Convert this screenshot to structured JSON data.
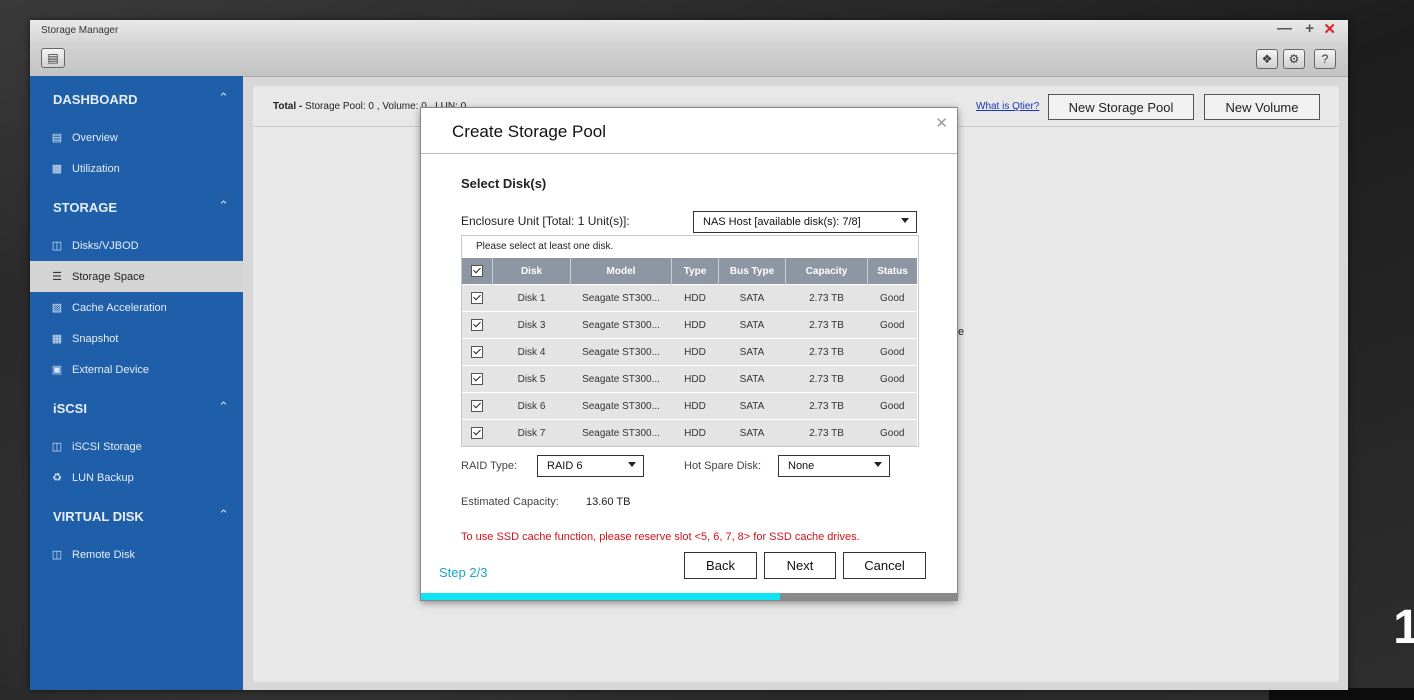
{
  "window": {
    "title": "Storage Manager"
  },
  "sidebar": {
    "sections": [
      {
        "label": "DASHBOARD",
        "items": [
          {
            "label": "Overview",
            "icon": "overview-icon"
          },
          {
            "label": "Utilization",
            "icon": "utilization-icon"
          }
        ]
      },
      {
        "label": "STORAGE",
        "items": [
          {
            "label": "Disks/VJBOD",
            "icon": "disk-icon"
          },
          {
            "label": "Storage Space",
            "icon": "storage-space-icon"
          },
          {
            "label": "Cache Acceleration",
            "icon": "cache-icon"
          },
          {
            "label": "Snapshot",
            "icon": "snapshot-icon"
          },
          {
            "label": "External Device",
            "icon": "external-device-icon"
          }
        ]
      },
      {
        "label": "iSCSI",
        "items": [
          {
            "label": "iSCSI Storage",
            "icon": "iscsi-storage-icon"
          },
          {
            "label": "LUN Backup",
            "icon": "lun-backup-icon"
          }
        ]
      },
      {
        "label": "VIRTUAL DISK",
        "items": [
          {
            "label": "Remote Disk",
            "icon": "remote-disk-icon"
          }
        ]
      }
    ],
    "active_item": "Storage Space"
  },
  "main": {
    "totals_prefix": "Total -",
    "totals_text": "Storage Pool: 0 , Volume: 0 , LUN: 0",
    "qtier_link": "What is Qtier?",
    "new_pool_button": "New Storage Pool",
    "new_volume_button": "New Volume",
    "stray_text": "e"
  },
  "dialog": {
    "title": "Create Storage Pool",
    "close_icon": "close-icon",
    "subhead": "Select Disk(s)",
    "enclosure_label": "Enclosure Unit [Total: 1 Unit(s)]:",
    "enclosure_value": "NAS Host [available disk(s): 7/8]",
    "hint": "Please select at least one disk.",
    "columns": [
      "Disk",
      "Model",
      "Type",
      "Bus Type",
      "Capacity",
      "Status"
    ],
    "rows": [
      {
        "disk": "Disk 1",
        "model": "Seagate ST300...",
        "type": "HDD",
        "bus": "SATA",
        "capacity": "2.73 TB",
        "status": "Good",
        "checked": true
      },
      {
        "disk": "Disk 3",
        "model": "Seagate ST300...",
        "type": "HDD",
        "bus": "SATA",
        "capacity": "2.73 TB",
        "status": "Good",
        "checked": true
      },
      {
        "disk": "Disk 4",
        "model": "Seagate ST300...",
        "type": "HDD",
        "bus": "SATA",
        "capacity": "2.73 TB",
        "status": "Good",
        "checked": true
      },
      {
        "disk": "Disk 5",
        "model": "Seagate ST300...",
        "type": "HDD",
        "bus": "SATA",
        "capacity": "2.73 TB",
        "status": "Good",
        "checked": true
      },
      {
        "disk": "Disk 6",
        "model": "Seagate ST300...",
        "type": "HDD",
        "bus": "SATA",
        "capacity": "2.73 TB",
        "status": "Good",
        "checked": true
      },
      {
        "disk": "Disk 7",
        "model": "Seagate ST300...",
        "type": "HDD",
        "bus": "SATA",
        "capacity": "2.73 TB",
        "status": "Good",
        "checked": true
      }
    ],
    "raid_label": "RAID Type:",
    "raid_value": "RAID 6",
    "spare_label": "Hot Spare Disk:",
    "spare_value": "None",
    "capacity_label": "Estimated Capacity:",
    "capacity_value": "13.60 TB",
    "warning": "To use SSD cache function, please reserve slot <5, 6, 7, 8> for SSD cache drives.",
    "step": "Step 2/3",
    "back_button": "Back",
    "next_button": "Next",
    "cancel_button": "Cancel",
    "progress_fraction": 0.67
  },
  "background": {
    "digit": "1"
  },
  "colors": {
    "sidebar": "#1f5ea8",
    "accent": "#1aa6c8",
    "progress": "#0fe5f2",
    "warning": "#d0131b"
  }
}
